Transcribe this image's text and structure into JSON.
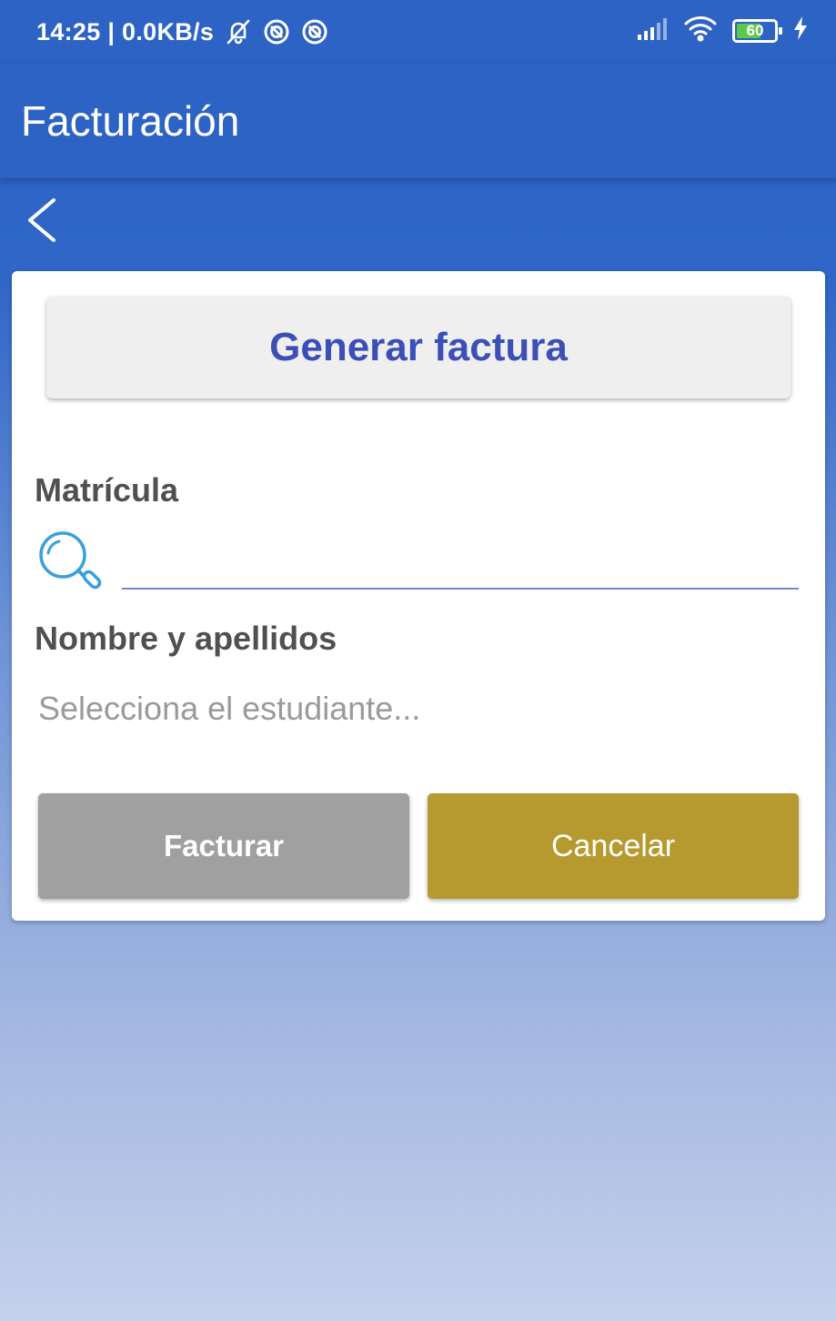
{
  "status_bar": {
    "time_speed": "14:25 | 0.0KB/s",
    "battery_level": "60"
  },
  "app_bar": {
    "title": "Facturación"
  },
  "form": {
    "header_button": "Generar factura",
    "matricula_label": "Matrícula",
    "matricula_value": "",
    "nombre_label": "Nombre y apellidos",
    "nombre_placeholder": "Selecciona el estudiante...",
    "facturar_button": "Facturar",
    "cancelar_button": "Cancelar"
  },
  "colors": {
    "primary": "#2c63c4",
    "header_button_text": "#3c4fb7",
    "facturar_bg": "#a0a0a0",
    "cancelar_bg": "#b79a2f",
    "input_underline": "#7b82d6",
    "search_icon": "#3aa0dc"
  },
  "icons": {
    "status": [
      "bell-off-icon",
      "sync-icon",
      "sync-icon",
      "signal-icon",
      "wifi-icon",
      "battery-icon",
      "charging-icon"
    ],
    "back": "chevron-left-icon",
    "search": "search-icon"
  }
}
